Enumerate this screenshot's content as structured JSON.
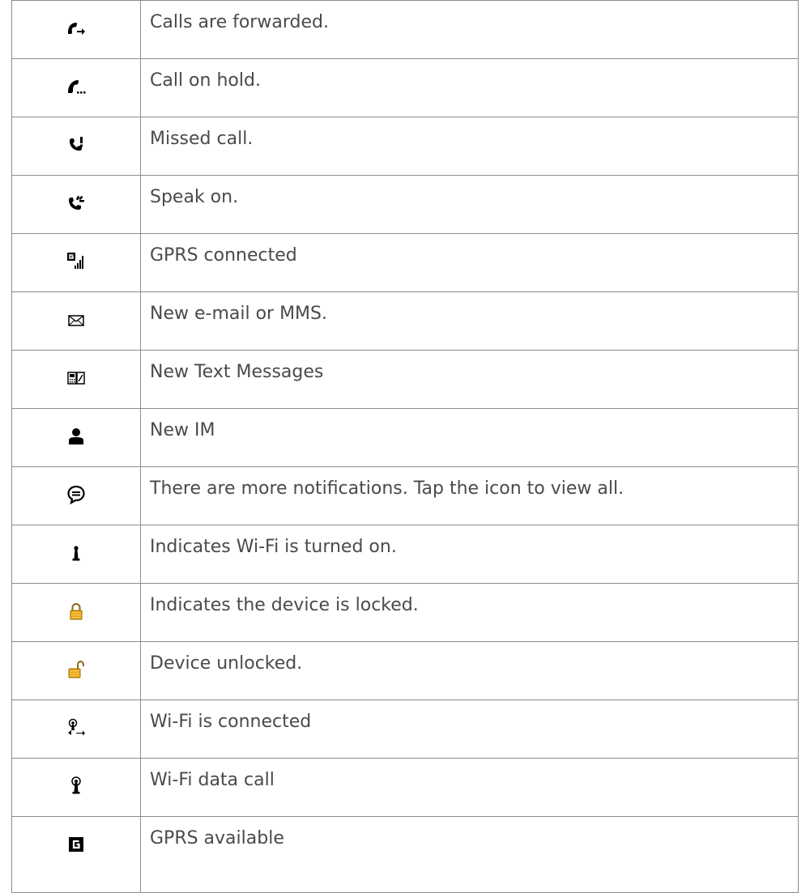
{
  "rows": [
    {
      "icon": "call-forwarded-icon",
      "text": "Calls are forwarded."
    },
    {
      "icon": "call-on-hold-icon",
      "text": "Call on hold."
    },
    {
      "icon": "missed-call-icon",
      "text": "Missed call."
    },
    {
      "icon": "speakerphone-on-icon",
      "text": "Speak on."
    },
    {
      "icon": "gprs-connected-icon",
      "text": "GPRS connected"
    },
    {
      "icon": "new-email-icon",
      "text": "New e-mail or MMS."
    },
    {
      "icon": "new-text-message-icon",
      "text": "New Text Messages"
    },
    {
      "icon": "new-im-icon",
      "text": "New IM"
    },
    {
      "icon": "more-notifications-icon",
      "text": "There are more notifications. Tap the icon to view all."
    },
    {
      "icon": "wifi-on-icon",
      "text": "Indicates Wi-Fi is turned on."
    },
    {
      "icon": "device-locked-icon",
      "text": "Indicates the device is locked."
    },
    {
      "icon": "device-unlocked-icon",
      "text": "Device unlocked."
    },
    {
      "icon": "wifi-connected-icon",
      "text": "Wi-Fi is connected"
    },
    {
      "icon": "wifi-data-call-icon",
      "text": "Wi-Fi data call"
    },
    {
      "icon": "gprs-available-icon",
      "text": "GPRS available"
    }
  ],
  "colors": {
    "text": "#4a4a4a",
    "border": "#8c8c8c",
    "lock": "#e8a317"
  }
}
